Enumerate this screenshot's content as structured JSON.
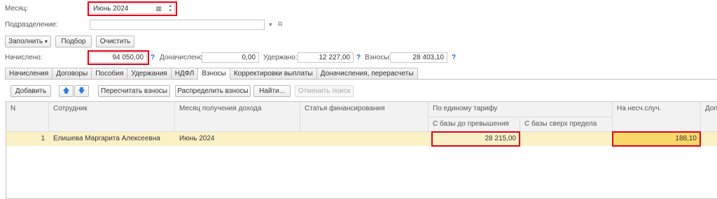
{
  "labels": {
    "month": "Месяц:",
    "department": "Подразделение:",
    "accrued": "Начислено:",
    "additional": "Доначислено:",
    "withheld": "Удержано:",
    "contributions": "Взносы:"
  },
  "fields": {
    "month_value": "Июнь 2024",
    "department_value": "",
    "accrued_value": "94 050,00",
    "additional_value": "0,00",
    "withheld_value": "12 227,00",
    "contributions_value": "28 403,10"
  },
  "help": "?",
  "buttons": {
    "fill": "Заполнить",
    "select": "Подбор",
    "clear": "Очистить"
  },
  "tabs": [
    "Начисления",
    "Договоры",
    "Пособия",
    "Удержания",
    "НДФЛ",
    "Взносы",
    "Корректировки выплаты",
    "Доначисления, перерасчеты"
  ],
  "active_tab": "Взносы",
  "toolbar": {
    "add": "Добавить",
    "recalc": "Пересчитать взносы",
    "distribute": "Распределить взносы",
    "find": "Найти...",
    "cancel_search": "Отменить поиск"
  },
  "table": {
    "headers": {
      "n": "N",
      "employee": "Сотрудник",
      "income_month": "Месяц получения дохода",
      "financing": "Статья финансирования",
      "unified": "По единому тарифу",
      "unified_base": "С базы до превышения",
      "unified_over": "С базы сверх предела",
      "accident": "На несч.случ.",
      "extra": "Доп"
    },
    "rows": [
      {
        "n": "1",
        "employee": "Елишева Маргарита Алексеевна",
        "income_month": "Июнь 2024",
        "financing": "",
        "unified_base": "28 215,00",
        "unified_over": "",
        "accident": "188,10"
      }
    ]
  },
  "colors": {
    "highlight_frame": "#e2001a",
    "selected_row": "#fbf1c7",
    "selected_cell": "#f9d96a",
    "help_mark": "#2a66c8"
  }
}
